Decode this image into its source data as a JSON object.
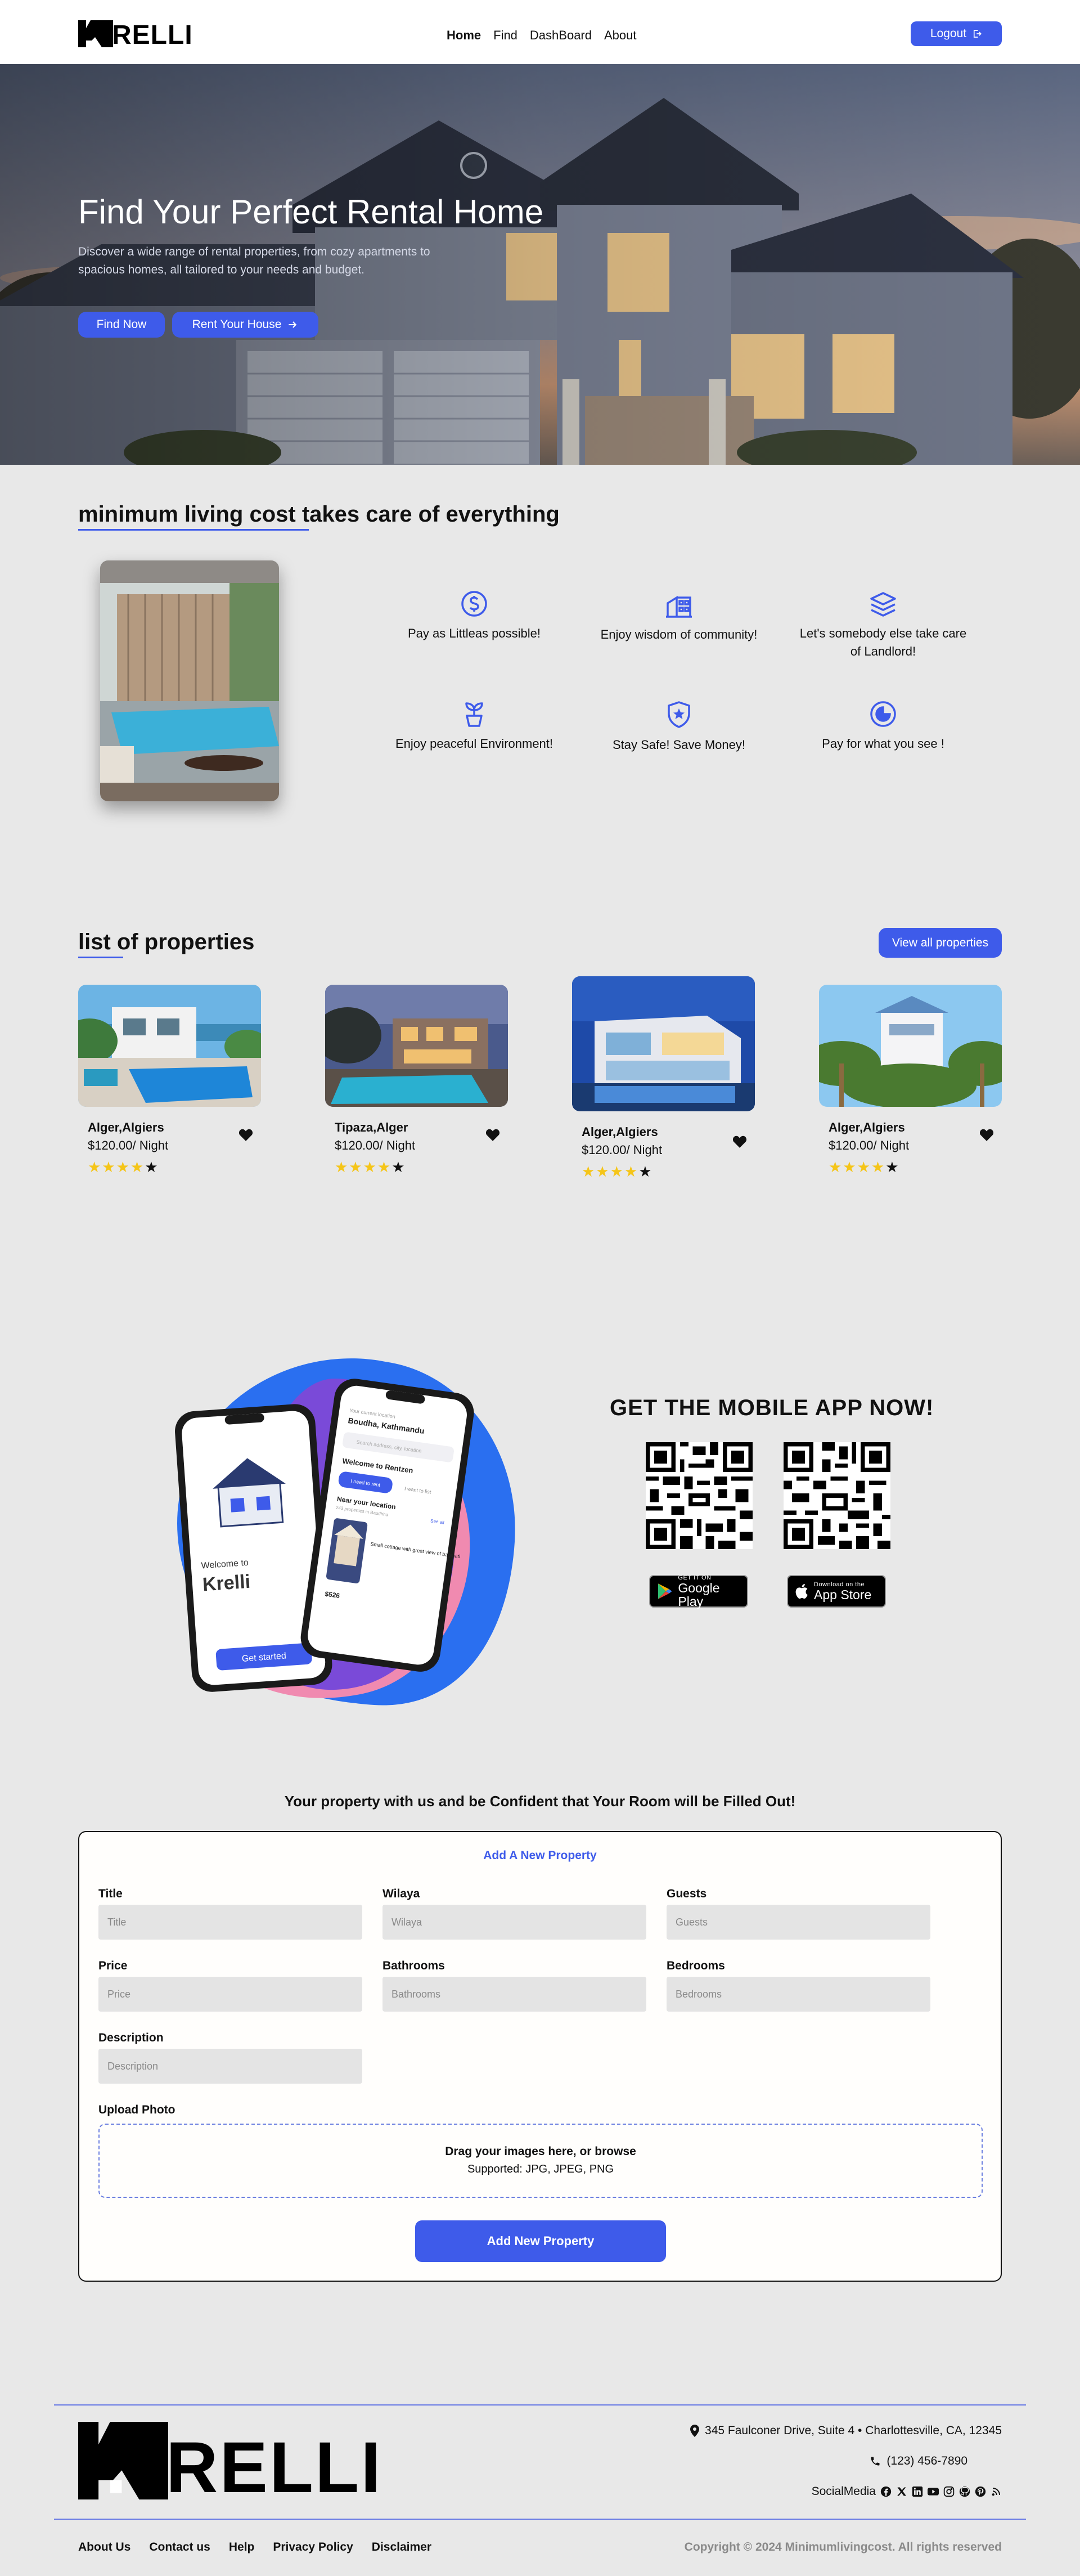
{
  "brand": {
    "name": "RELLI"
  },
  "nav": {
    "links": [
      "Home",
      "Find",
      "DashBoard",
      "About"
    ],
    "logout_label": "Logout"
  },
  "hero": {
    "title": "Find Your Perfect Rental Home",
    "subtitle": "Discover a wide range of rental properties, from cozy apartments to spacious homes, all tailored to your needs and budget.",
    "btn_find": "Find Now",
    "btn_rent": "Rent Your House"
  },
  "features": {
    "title_highlight": "minimum living cost",
    "title_rest": " takes care of everything",
    "items": [
      {
        "icon": "dollar-icon",
        "label": "Pay as Littleas possible!"
      },
      {
        "icon": "community-icon",
        "label": "Enjoy wisdom of community!"
      },
      {
        "icon": "layers-icon",
        "label": "Let's somebody else take care of Landlord!"
      },
      {
        "icon": "plant-icon",
        "label": "Enjoy peaceful Environment!"
      },
      {
        "icon": "shield-star-icon",
        "label": "Stay Safe! Save Money!"
      },
      {
        "icon": "pie-icon",
        "label": "Pay for what you see !"
      }
    ]
  },
  "properties": {
    "title_highlight": "list",
    "title_rest": " of properties",
    "view_all_label": "View all properties",
    "items": [
      {
        "location": "Alger,Algiers",
        "price": "$120.00/ Night",
        "rating": 4
      },
      {
        "location": "Tipaza,Alger",
        "price": "$120.00/ Night",
        "rating": 4
      },
      {
        "location": "Alger,Algiers",
        "price": "$120.00/ Night",
        "rating": 4
      },
      {
        "location": "Alger,Algiers",
        "price": "$120.00/ Night",
        "rating": 4
      }
    ]
  },
  "app": {
    "title": "GET THE MOBILE APP NOW!",
    "google_small": "GET IT ON",
    "google_big": "Google Play",
    "apple_small": "Download on the",
    "apple_big": "App Store",
    "phone_left": {
      "welcome": "Welcome to",
      "brand": "Krelli",
      "cta": "Get started"
    },
    "phone_right": {
      "location_caption": "Your current location",
      "location": "Boudha, Kathmandu",
      "search_placeholder": "Search address, city, location",
      "welcome": "Welcome to Rentzen",
      "tab_rent": "I need to rent",
      "tab_list": "I want to list",
      "near": "Near your location",
      "near_sub": "243 properties in Baudhha",
      "see_all": "See all",
      "listing": "Small cottage with great view of bagmati",
      "price": "$526"
    }
  },
  "form": {
    "heading": "Your property with us and be Confident that Your Room will be Filled Out!",
    "subheading": "Add A New Property",
    "fields": {
      "title": {
        "label": "Title",
        "placeholder": "Title"
      },
      "wilaya": {
        "label": "Wilaya",
        "placeholder": "Wilaya"
      },
      "guests": {
        "label": "Guests",
        "placeholder": "Guests"
      },
      "price": {
        "label": "Price",
        "placeholder": "Price"
      },
      "bathrooms": {
        "label": "Bathrooms",
        "placeholder": "Bathrooms"
      },
      "bedrooms": {
        "label": "Bedrooms",
        "placeholder": "Bedrooms"
      },
      "description": {
        "label": "Description",
        "placeholder": "Description"
      }
    },
    "upload_label": "Upload Photo",
    "drop_title": "Drag your images here, or browse",
    "drop_supported": "Supported: JPG, JPEG, PNG",
    "submit_label": "Add New Property"
  },
  "footer": {
    "address": "345 Faulconer Drive, Suite 4 • Charlottesville, CA, 12345",
    "phone": "(123) 456-7890",
    "social_label": "SocialMedia",
    "links": [
      "About Us",
      "Contact us",
      "Help",
      "Privacy Policy",
      "Disclaimer"
    ],
    "copyright": "Copyright © 2024 Minimumlivingcost. All rights reserved"
  },
  "colors": {
    "accent": "#3e5bea",
    "star": "#f5c518",
    "page_bg": "#e8e8e8"
  }
}
